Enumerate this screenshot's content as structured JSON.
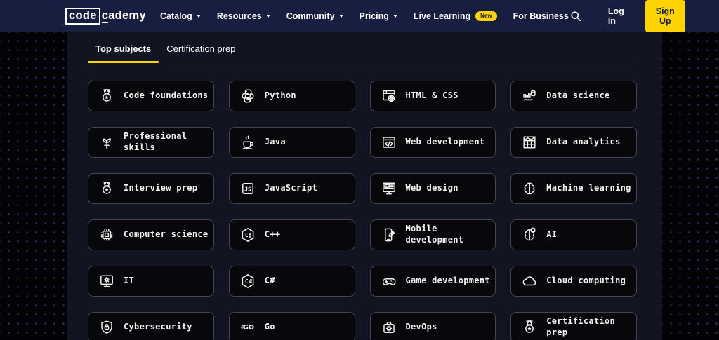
{
  "navbar": {
    "logo": {
      "boxed": "code",
      "cursor_letter": "c",
      "rest": "ademy"
    },
    "items": [
      {
        "label": "Catalog",
        "has_caret": true
      },
      {
        "label": "Resources",
        "has_caret": true
      },
      {
        "label": "Community",
        "has_caret": true
      },
      {
        "label": "Pricing",
        "has_caret": true
      },
      {
        "label": "Live Learning",
        "badge": "New"
      },
      {
        "label": "For Business"
      }
    ],
    "search_icon": "magnifier",
    "login_label": "Log In",
    "signup_label": "Sign Up"
  },
  "tabs": [
    {
      "label": "Top subjects",
      "active": true
    },
    {
      "label": "Certification prep",
      "active": false
    }
  ],
  "subjects": [
    {
      "label": "Code foundations",
      "icon": "medal-icon"
    },
    {
      "label": "Python",
      "icon": "python-icon"
    },
    {
      "label": "HTML & CSS",
      "icon": "browser-globe-icon"
    },
    {
      "label": "Data science",
      "icon": "chart-database-icon"
    },
    {
      "label": "Professional skills",
      "icon": "plant-icon"
    },
    {
      "label": "Java",
      "icon": "coffee-cup-icon"
    },
    {
      "label": "Web development",
      "icon": "browser-code-icon"
    },
    {
      "label": "Data analytics",
      "icon": "table-chart-icon"
    },
    {
      "label": "Interview prep",
      "icon": "medal-star-icon"
    },
    {
      "label": "JavaScript",
      "icon": "js-badge-icon"
    },
    {
      "label": "Web design",
      "icon": "monitor-image-icon"
    },
    {
      "label": "Machine learning",
      "icon": "brain-icon"
    },
    {
      "label": "Computer science",
      "icon": "chip-icon"
    },
    {
      "label": "C++",
      "icon": "cpp-hexagon-icon"
    },
    {
      "label": "Mobile development",
      "icon": "phone-rocket-icon"
    },
    {
      "label": "AI",
      "icon": "ai-chip-icon"
    },
    {
      "label": "IT",
      "icon": "monitor-gear-icon"
    },
    {
      "label": "C#",
      "icon": "csharp-hexagon-icon"
    },
    {
      "label": "Game development",
      "icon": "gamepad-icon"
    },
    {
      "label": "Cloud computing",
      "icon": "cloud-icon"
    },
    {
      "label": "Cybersecurity",
      "icon": "shield-lock-icon"
    },
    {
      "label": "Go",
      "icon": "go-logo-icon"
    },
    {
      "label": "DevOps",
      "icon": "toolbox-gear-icon"
    },
    {
      "label": "Certification prep",
      "icon": "medal-ribbon-icon"
    }
  ],
  "colors": {
    "accent_yellow": "#ffd302",
    "navbar_background": "#171e3f",
    "page_background": "#131421",
    "gutter_background": "#030307",
    "dot_color": "#31316c",
    "card_background": "#07070c",
    "card_border": "#45454f",
    "tab_divider": "#54545e"
  }
}
